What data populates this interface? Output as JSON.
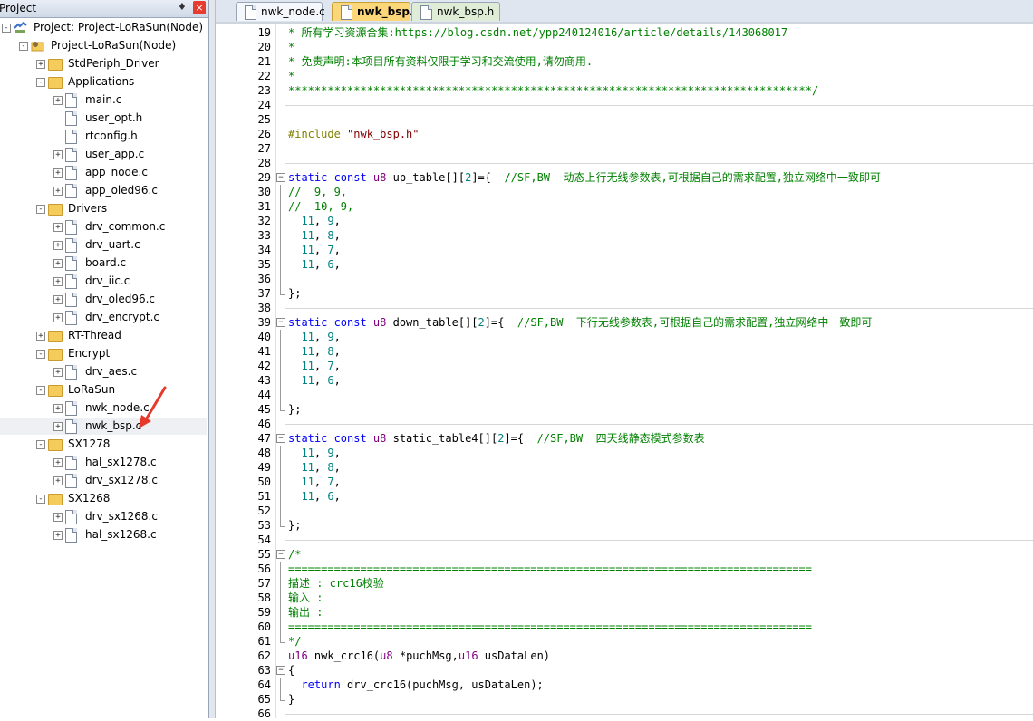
{
  "project_panel": {
    "title": "Project",
    "pin_glyph": "♦",
    "close_glyph": "×",
    "tree": [
      {
        "label": "Project: Project-LoRaSun(Node)",
        "level": 0,
        "kind": "project",
        "expander": "-"
      },
      {
        "label": "Project-LoRaSun(Node)",
        "level": 1,
        "kind": "target",
        "expander": "-"
      },
      {
        "label": "StdPeriph_Driver",
        "level": 2,
        "kind": "folder",
        "expander": "+"
      },
      {
        "label": "Applications",
        "level": 2,
        "kind": "folder",
        "expander": "-"
      },
      {
        "label": "main.c",
        "level": 3,
        "kind": "file",
        "expander": "+"
      },
      {
        "label": "user_opt.h",
        "level": 3,
        "kind": "file",
        "expander": ""
      },
      {
        "label": "rtconfig.h",
        "level": 3,
        "kind": "file",
        "expander": ""
      },
      {
        "label": "user_app.c",
        "level": 3,
        "kind": "file",
        "expander": "+"
      },
      {
        "label": "app_node.c",
        "level": 3,
        "kind": "file",
        "expander": "+"
      },
      {
        "label": "app_oled96.c",
        "level": 3,
        "kind": "file",
        "expander": "+"
      },
      {
        "label": "Drivers",
        "level": 2,
        "kind": "folder",
        "expander": "-"
      },
      {
        "label": "drv_common.c",
        "level": 3,
        "kind": "file",
        "expander": "+"
      },
      {
        "label": "drv_uart.c",
        "level": 3,
        "kind": "file",
        "expander": "+"
      },
      {
        "label": "board.c",
        "level": 3,
        "kind": "file",
        "expander": "+"
      },
      {
        "label": "drv_iic.c",
        "level": 3,
        "kind": "file",
        "expander": "+"
      },
      {
        "label": "drv_oled96.c",
        "level": 3,
        "kind": "file",
        "expander": "+"
      },
      {
        "label": "drv_encrypt.c",
        "level": 3,
        "kind": "file",
        "expander": "+"
      },
      {
        "label": "RT-Thread",
        "level": 2,
        "kind": "folder",
        "expander": "+"
      },
      {
        "label": "Encrypt",
        "level": 2,
        "kind": "folder",
        "expander": "-"
      },
      {
        "label": "drv_aes.c",
        "level": 3,
        "kind": "file",
        "expander": "+"
      },
      {
        "label": "LoRaSun",
        "level": 2,
        "kind": "folder",
        "expander": "-"
      },
      {
        "label": "nwk_node.c",
        "level": 3,
        "kind": "file",
        "expander": "+"
      },
      {
        "label": "nwk_bsp.c",
        "level": 3,
        "kind": "file",
        "expander": "+",
        "selected": true
      },
      {
        "label": "SX1278",
        "level": 2,
        "kind": "folder",
        "expander": "-"
      },
      {
        "label": "hal_sx1278.c",
        "level": 3,
        "kind": "file",
        "expander": "+"
      },
      {
        "label": "drv_sx1278.c",
        "level": 3,
        "kind": "file",
        "expander": "+"
      },
      {
        "label": "SX1268",
        "level": 2,
        "kind": "folder",
        "expander": "-"
      },
      {
        "label": "drv_sx1268.c",
        "level": 3,
        "kind": "file",
        "expander": "+"
      },
      {
        "label": "hal_sx1268.c",
        "level": 3,
        "kind": "file",
        "expander": "+"
      }
    ]
  },
  "editor": {
    "tabs": [
      {
        "label": "nwk_node.c",
        "active": false
      },
      {
        "label": "nwk_bsp.c",
        "active": true
      },
      {
        "label": "nwk_bsp.h",
        "active": false
      }
    ],
    "lines": [
      {
        "n": "19",
        "fold": "",
        "sep": false,
        "parts": [
          [
            "com",
            "* 所有学习资源合集:https://blog.csdn.net/ypp240124016/article/details/143068017"
          ]
        ]
      },
      {
        "n": "20",
        "fold": "",
        "sep": false,
        "parts": [
          [
            "com",
            "*"
          ]
        ]
      },
      {
        "n": "21",
        "fold": "",
        "sep": false,
        "parts": [
          [
            "com",
            "* 免责声明:本项目所有资料仅限于学习和交流使用,请勿商用."
          ]
        ]
      },
      {
        "n": "22",
        "fold": "",
        "sep": false,
        "parts": [
          [
            "com",
            "*"
          ]
        ]
      },
      {
        "n": "23",
        "fold": "",
        "sep": false,
        "parts": [
          [
            "com",
            "********************************************************************************/"
          ]
        ]
      },
      {
        "n": "24",
        "fold": "",
        "sep": true,
        "parts": []
      },
      {
        "n": "25",
        "fold": "",
        "sep": false,
        "parts": []
      },
      {
        "n": "26",
        "fold": "",
        "sep": false,
        "parts": [
          [
            "pre",
            "#include "
          ],
          [
            "str",
            "\"nwk_bsp.h\""
          ]
        ]
      },
      {
        "n": "27",
        "fold": "",
        "sep": false,
        "parts": []
      },
      {
        "n": "28",
        "fold": "",
        "sep": true,
        "parts": []
      },
      {
        "n": "29",
        "fold": "-",
        "sep": false,
        "parts": [
          [
            "kw",
            "static const "
          ],
          [
            "typ",
            "u8 "
          ],
          [
            "plain",
            "up_table[]["
          ],
          [
            "num",
            "2"
          ],
          [
            "plain",
            "]={  "
          ],
          [
            "com",
            "//SF,BW  动态上行无线参数表,可根据自己的需求配置,独立网络中一致即可"
          ]
        ]
      },
      {
        "n": "30",
        "fold": "|",
        "sep": false,
        "parts": [
          [
            "com",
            "//  9, 9,"
          ]
        ]
      },
      {
        "n": "31",
        "fold": "|",
        "sep": false,
        "parts": [
          [
            "com",
            "//  10, 9,"
          ]
        ]
      },
      {
        "n": "32",
        "fold": "|",
        "sep": false,
        "parts": [
          [
            "num",
            "  11"
          ],
          [
            "plain",
            ", "
          ],
          [
            "num",
            "9"
          ],
          [
            "plain",
            ","
          ]
        ]
      },
      {
        "n": "33",
        "fold": "|",
        "sep": false,
        "parts": [
          [
            "num",
            "  11"
          ],
          [
            "plain",
            ", "
          ],
          [
            "num",
            "8"
          ],
          [
            "plain",
            ","
          ]
        ]
      },
      {
        "n": "34",
        "fold": "|",
        "sep": false,
        "parts": [
          [
            "num",
            "  11"
          ],
          [
            "plain",
            ", "
          ],
          [
            "num",
            "7"
          ],
          [
            "plain",
            ","
          ]
        ]
      },
      {
        "n": "35",
        "fold": "|",
        "sep": false,
        "parts": [
          [
            "num",
            "  11"
          ],
          [
            "plain",
            ", "
          ],
          [
            "num",
            "6"
          ],
          [
            "plain",
            ","
          ]
        ]
      },
      {
        "n": "36",
        "fold": "|",
        "sep": false,
        "parts": []
      },
      {
        "n": "37",
        "fold": "L",
        "sep": false,
        "parts": [
          [
            "plain",
            "};"
          ]
        ]
      },
      {
        "n": "38",
        "fold": "",
        "sep": true,
        "parts": []
      },
      {
        "n": "39",
        "fold": "-",
        "sep": false,
        "parts": [
          [
            "kw",
            "static const "
          ],
          [
            "typ",
            "u8 "
          ],
          [
            "plain",
            "down_table[]["
          ],
          [
            "num",
            "2"
          ],
          [
            "plain",
            "]={  "
          ],
          [
            "com",
            "//SF,BW  下行无线参数表,可根据自己的需求配置,独立网络中一致即可"
          ]
        ]
      },
      {
        "n": "40",
        "fold": "|",
        "sep": false,
        "parts": [
          [
            "num",
            "  11"
          ],
          [
            "plain",
            ", "
          ],
          [
            "num",
            "9"
          ],
          [
            "plain",
            ","
          ]
        ]
      },
      {
        "n": "41",
        "fold": "|",
        "sep": false,
        "parts": [
          [
            "num",
            "  11"
          ],
          [
            "plain",
            ", "
          ],
          [
            "num",
            "8"
          ],
          [
            "plain",
            ","
          ]
        ]
      },
      {
        "n": "42",
        "fold": "|",
        "sep": false,
        "parts": [
          [
            "num",
            "  11"
          ],
          [
            "plain",
            ", "
          ],
          [
            "num",
            "7"
          ],
          [
            "plain",
            ","
          ]
        ]
      },
      {
        "n": "43",
        "fold": "|",
        "sep": false,
        "parts": [
          [
            "num",
            "  11"
          ],
          [
            "plain",
            ", "
          ],
          [
            "num",
            "6"
          ],
          [
            "plain",
            ","
          ]
        ]
      },
      {
        "n": "44",
        "fold": "|",
        "sep": false,
        "parts": []
      },
      {
        "n": "45",
        "fold": "L",
        "sep": false,
        "parts": [
          [
            "plain",
            "};"
          ]
        ]
      },
      {
        "n": "46",
        "fold": "",
        "sep": true,
        "parts": []
      },
      {
        "n": "47",
        "fold": "-",
        "sep": false,
        "parts": [
          [
            "kw",
            "static const "
          ],
          [
            "typ",
            "u8 "
          ],
          [
            "plain",
            "static_table4[]["
          ],
          [
            "num",
            "2"
          ],
          [
            "plain",
            "]={  "
          ],
          [
            "com",
            "//SF,BW  四天线静态模式参数表"
          ]
        ]
      },
      {
        "n": "48",
        "fold": "|",
        "sep": false,
        "parts": [
          [
            "num",
            "  11"
          ],
          [
            "plain",
            ", "
          ],
          [
            "num",
            "9"
          ],
          [
            "plain",
            ","
          ]
        ]
      },
      {
        "n": "49",
        "fold": "|",
        "sep": false,
        "parts": [
          [
            "num",
            "  11"
          ],
          [
            "plain",
            ", "
          ],
          [
            "num",
            "8"
          ],
          [
            "plain",
            ","
          ]
        ]
      },
      {
        "n": "50",
        "fold": "|",
        "sep": false,
        "parts": [
          [
            "num",
            "  11"
          ],
          [
            "plain",
            ", "
          ],
          [
            "num",
            "7"
          ],
          [
            "plain",
            ","
          ]
        ]
      },
      {
        "n": "51",
        "fold": "|",
        "sep": false,
        "parts": [
          [
            "num",
            "  11"
          ],
          [
            "plain",
            ", "
          ],
          [
            "num",
            "6"
          ],
          [
            "plain",
            ","
          ]
        ]
      },
      {
        "n": "52",
        "fold": "|",
        "sep": false,
        "parts": []
      },
      {
        "n": "53",
        "fold": "L",
        "sep": false,
        "parts": [
          [
            "plain",
            "};"
          ]
        ]
      },
      {
        "n": "54",
        "fold": "",
        "sep": true,
        "parts": []
      },
      {
        "n": "55",
        "fold": "-",
        "sep": false,
        "parts": [
          [
            "com",
            "/*"
          ]
        ]
      },
      {
        "n": "56",
        "fold": "|",
        "sep": false,
        "parts": [
          [
            "com",
            "================================================================================"
          ]
        ]
      },
      {
        "n": "57",
        "fold": "|",
        "sep": false,
        "parts": [
          [
            "com",
            "描述 : crc16校验"
          ]
        ]
      },
      {
        "n": "58",
        "fold": "|",
        "sep": false,
        "parts": [
          [
            "com",
            "输入 :"
          ]
        ]
      },
      {
        "n": "59",
        "fold": "|",
        "sep": false,
        "parts": [
          [
            "com",
            "输出 :"
          ]
        ]
      },
      {
        "n": "60",
        "fold": "|",
        "sep": false,
        "parts": [
          [
            "com",
            "================================================================================"
          ]
        ]
      },
      {
        "n": "61",
        "fold": "L",
        "sep": false,
        "parts": [
          [
            "com",
            "*/"
          ]
        ]
      },
      {
        "n": "62",
        "fold": "",
        "sep": false,
        "parts": [
          [
            "typ",
            "u16 "
          ],
          [
            "plain",
            "nwk_crc16("
          ],
          [
            "typ",
            "u8 "
          ],
          [
            "plain",
            "*puchMsg,"
          ],
          [
            "typ",
            "u16 "
          ],
          [
            "plain",
            "usDataLen)"
          ]
        ]
      },
      {
        "n": "63",
        "fold": "-",
        "sep": false,
        "parts": [
          [
            "plain",
            "{"
          ]
        ]
      },
      {
        "n": "64",
        "fold": "|",
        "sep": false,
        "parts": [
          [
            "kw",
            "  return "
          ],
          [
            "plain",
            "drv_crc16(puchMsg, usDataLen);"
          ]
        ]
      },
      {
        "n": "65",
        "fold": "L",
        "sep": false,
        "parts": [
          [
            "plain",
            "}"
          ]
        ]
      },
      {
        "n": "66",
        "fold": "",
        "sep": true,
        "parts": []
      }
    ]
  },
  "colors": {
    "comment": "#008000",
    "preprocessor": "#808000",
    "string": "#800000",
    "keyword": "#0000ff",
    "type": "#800080",
    "number": "#008080",
    "annotation_arrow": "#e53a2b",
    "active_tab": "#fcd77a"
  }
}
